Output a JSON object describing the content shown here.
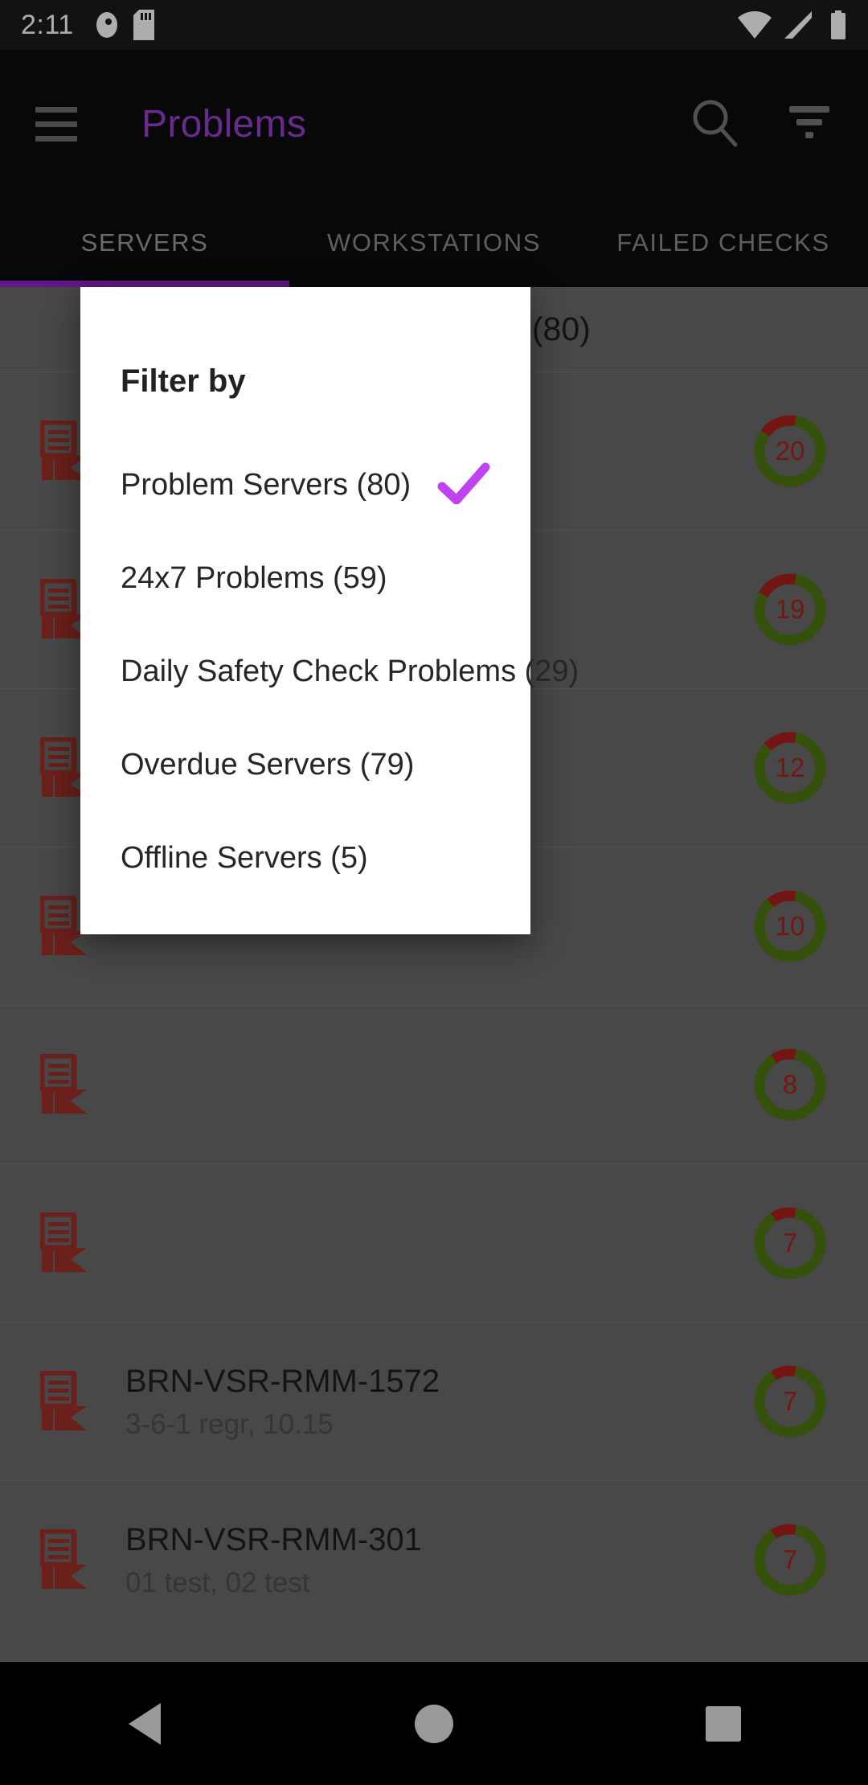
{
  "status_bar": {
    "time": "2:11",
    "left_icons": [
      "app-notification-icon",
      "sd-card-icon"
    ],
    "right_icons": [
      "wifi-icon",
      "cellular-signal-icon",
      "battery-icon"
    ]
  },
  "app_bar": {
    "menu_icon": "hamburger-menu-icon",
    "title": "Problems",
    "title_color": "#9b3fd4",
    "search_icon": "search-icon",
    "filter_icon": "filter-icon"
  },
  "tabs": {
    "items": [
      {
        "label": "SERVERS",
        "active": true
      },
      {
        "label": "WORKSTATIONS",
        "active": false
      },
      {
        "label": "FAILED CHECKS",
        "active": false
      }
    ],
    "indicator_color": "#8e24c9"
  },
  "list": {
    "header": "Problem Servers (80)",
    "rows": [
      {
        "icon": "server-error-icon",
        "title": "",
        "subtitle": "",
        "badge": "20",
        "green_pct": 82
      },
      {
        "icon": "server-error-icon",
        "title": "",
        "subtitle": "",
        "badge": "19",
        "green_pct": 80
      },
      {
        "icon": "server-error-icon",
        "title": "",
        "subtitle": "",
        "badge": "12",
        "green_pct": 84
      },
      {
        "icon": "server-error-icon",
        "title": "",
        "subtitle": "",
        "badge": "10",
        "green_pct": 86
      },
      {
        "icon": "server-error-icon",
        "title": "",
        "subtitle": "",
        "badge": "8",
        "green_pct": 88
      },
      {
        "icon": "server-error-icon",
        "title": "",
        "subtitle": "",
        "badge": "7",
        "green_pct": 88
      },
      {
        "icon": "server-error-icon",
        "title": "BRN-VSR-RMM-1572",
        "subtitle": "3-6-1 regr, 10.15",
        "badge": "7",
        "green_pct": 88
      },
      {
        "icon": "server-error-icon",
        "title": "BRN-VSR-RMM-301",
        "subtitle": "01 test, 02 test",
        "badge": "7",
        "green_pct": 88
      }
    ],
    "donut_green": "#4f7a14",
    "donut_red": "#a8201d",
    "badge_text_color": "#b0201d"
  },
  "dialog": {
    "title": "Filter by",
    "check_icon": "check-icon",
    "check_color": "#bf43f0",
    "options": [
      {
        "label": "Problem Servers (80)",
        "selected": true
      },
      {
        "label": "24x7 Problems (59)",
        "selected": false
      },
      {
        "label": "Daily Safety Check Problems (29)",
        "selected": false
      },
      {
        "label": "Overdue Servers (79)",
        "selected": false
      },
      {
        "label": "Offline Servers (5)",
        "selected": false
      }
    ]
  },
  "nav_bar": {
    "back": "back-triangle-icon",
    "home": "home-circle-icon",
    "recents": "recents-square-icon"
  }
}
